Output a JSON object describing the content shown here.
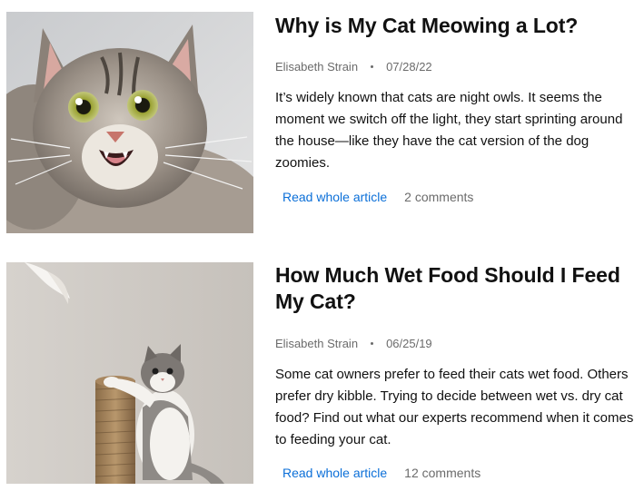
{
  "articles": [
    {
      "title": "Why is My Cat Meowing a Lot?",
      "author": "Elisabeth Strain",
      "date": "07/28/22",
      "excerpt": "It’s widely known that cats are night owls. It seems the moment we switch off the light, they start sprinting around the house—like they have the cat version of the dog zoomies.",
      "read_label": "Read whole article",
      "comments": "2 comments",
      "image": "meowing-tabby-cat-photo"
    },
    {
      "title": "How Much Wet Food Should I Feed My Cat?",
      "author": "Elisabeth Strain",
      "date": "06/25/19",
      "excerpt": "Some cat owners prefer to feed their cats wet food. Others prefer dry kibble. Trying to decide between wet vs. dry cat food? Find out what our experts recommend when it comes to feeding your cat.",
      "read_label": "Read whole article",
      "comments": "12 comments",
      "image": "kitten-scratching-post-photo"
    }
  ],
  "colors": {
    "link": "#0b6fd8",
    "meta": "#6b6b6b",
    "text": "#111111"
  }
}
